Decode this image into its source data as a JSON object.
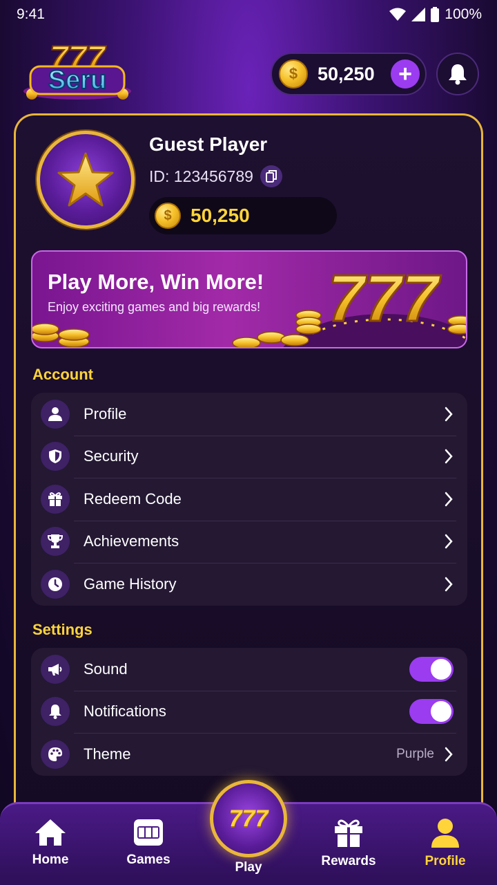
{
  "status_bar": {
    "time": "9:41",
    "battery": "100%"
  },
  "header": {
    "logo_text": "Seru",
    "logo_number": "777",
    "coin_balance": "50,250",
    "add_coins_label": "+"
  },
  "profile": {
    "name": "Guest Player",
    "id": "ID: 123456789",
    "balance": "50,250"
  },
  "banner": {
    "title": "Play More, Win More!",
    "subtitle": "Enjoy exciting games and big rewards!",
    "graphic_text": "777"
  },
  "account": {
    "title": "Account",
    "items": [
      {
        "label": "Profile",
        "icon": "user-icon"
      },
      {
        "label": "Security",
        "icon": "shield-icon"
      },
      {
        "label": "Redeem Code",
        "icon": "gift-icon"
      },
      {
        "label": "Achievements",
        "icon": "trophy-icon"
      },
      {
        "label": "Game History",
        "icon": "clock-icon"
      }
    ]
  },
  "settings": {
    "title": "Settings",
    "items": [
      {
        "label": "Sound",
        "icon": "megaphone-icon",
        "toggle": true
      },
      {
        "label": "Notifications",
        "icon": "bell-icon",
        "toggle": true
      },
      {
        "label": "Theme",
        "icon": "palette-icon",
        "value": "Purple"
      }
    ]
  },
  "nav": {
    "items": [
      {
        "label": "Home",
        "icon": "home-icon"
      },
      {
        "label": "Games",
        "icon": "slot-machine-icon"
      },
      {
        "label": "Play",
        "icon": "777-icon",
        "center_text": "777"
      },
      {
        "label": "Rewards",
        "icon": "gift-icon"
      },
      {
        "label": "Profile",
        "icon": "user-icon",
        "active": true
      }
    ]
  },
  "colors": {
    "accent_gold": "#ffd43a",
    "accent_purple": "#9b3cf0",
    "card_border": "#e9b63a"
  }
}
